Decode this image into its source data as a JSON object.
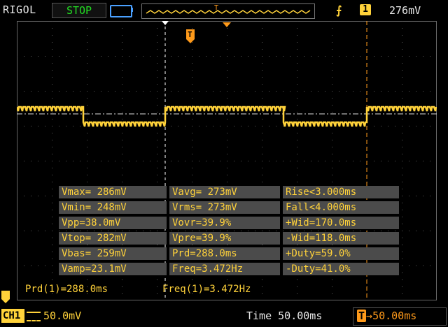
{
  "header": {
    "brand": "RIGOL",
    "run_state": "STOP",
    "trigger_source": "1",
    "trigger_level": "276mV",
    "trigger_marker": "T"
  },
  "colors": {
    "channel1": "#ffd23a",
    "trigger_orange": "#ff9a1a",
    "run_state_green": "#22dd22",
    "grid": "#606060"
  },
  "icons": {
    "trigger_edge": "rising-edge-icon",
    "battery": "battery-icon",
    "coupling": "dc-coupling-icon"
  },
  "measurements": [
    [
      "Vmax= 286mV",
      "Vavg= 273mV",
      "Rise<3.000ms"
    ],
    [
      "Vmin= 248mV",
      "Vrms= 273mV",
      "Fall<4.000ms"
    ],
    [
      "Vpp=38.0mV",
      "Vovr=39.9%",
      "+Wid=170.0ms"
    ],
    [
      "Vtop= 282mV",
      "Vpre=39.9%",
      "-Wid=118.0ms"
    ],
    [
      "Vbas= 259mV",
      "Prd=288.0ms",
      "+Duty=59.0%"
    ],
    [
      "Vamp=23.1mV",
      "Freq=3.472Hz",
      "-Duty=41.0%"
    ]
  ],
  "cursor_readouts": {
    "prd": "Prd(1)=288.0ms",
    "freq": "Freq(1)=3.472Hz"
  },
  "footer": {
    "channel": "CH1",
    "volts_per_div": "50.0mV",
    "timebase": "Time 50.00ms",
    "trigger_offset": "50.00ms",
    "trigger_offset_prefix": "T"
  }
}
